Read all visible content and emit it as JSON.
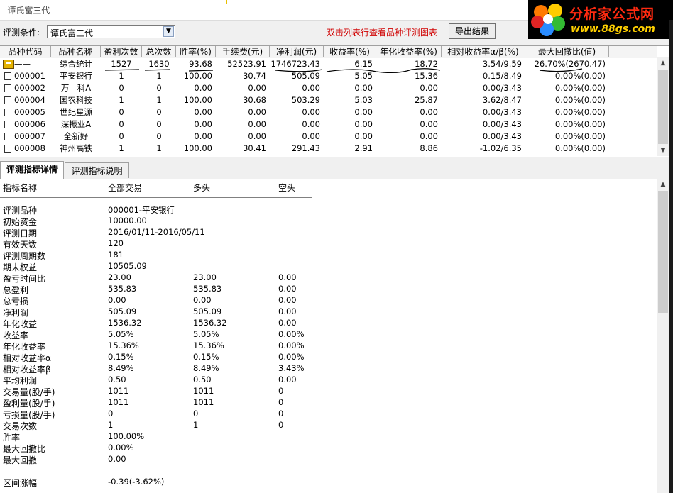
{
  "window": {
    "title": "-谭氏富三代"
  },
  "logo": {
    "name": "分析家公式网",
    "url": "www.88gs.com"
  },
  "toolbar": {
    "condition_label": "评测条件:",
    "condition_value": "谭氏富三代",
    "hint": "双击列表行查看品种评测图表",
    "export_label": "导出结果"
  },
  "table": {
    "headers": [
      "品种代码",
      "品种名称",
      "盈利次数",
      "总次数",
      "胜率(%)",
      "手续费(元)",
      "净利润(元)",
      "收益率(%)",
      "年化收益率(%)",
      "相对收益率α/β(%)",
      "最大回撤比(值)"
    ],
    "summary": {
      "code": "——",
      "name": "综合统计",
      "win_count": "1527",
      "total_count": "1630",
      "win_rate": "93.68",
      "fee": "52523.91",
      "net_profit": "1746723.43",
      "return_rate": "6.15",
      "annual_return": "18.72",
      "alpha_beta": "3.54/9.59",
      "max_drawdown": "26.70%(2670.47)"
    },
    "rows": [
      {
        "code": "000001",
        "name": "平安银行",
        "win_count": "1",
        "total_count": "1",
        "win_rate": "100.00",
        "fee": "30.74",
        "net_profit": "505.09",
        "return_rate": "5.05",
        "annual_return": "15.36",
        "alpha_beta": "0.15/8.49",
        "max_drawdown": "0.00%(0.00)"
      },
      {
        "code": "000002",
        "name": "万　科A",
        "win_count": "0",
        "total_count": "0",
        "win_rate": "0.00",
        "fee": "0.00",
        "net_profit": "0.00",
        "return_rate": "0.00",
        "annual_return": "0.00",
        "alpha_beta": "0.00/3.43",
        "max_drawdown": "0.00%(0.00)"
      },
      {
        "code": "000004",
        "name": "国农科技",
        "win_count": "1",
        "total_count": "1",
        "win_rate": "100.00",
        "fee": "30.68",
        "net_profit": "503.29",
        "return_rate": "5.03",
        "annual_return": "25.87",
        "alpha_beta": "3.62/8.47",
        "max_drawdown": "0.00%(0.00)"
      },
      {
        "code": "000005",
        "name": "世纪星源",
        "win_count": "0",
        "total_count": "0",
        "win_rate": "0.00",
        "fee": "0.00",
        "net_profit": "0.00",
        "return_rate": "0.00",
        "annual_return": "0.00",
        "alpha_beta": "0.00/3.43",
        "max_drawdown": "0.00%(0.00)"
      },
      {
        "code": "000006",
        "name": "深振业A",
        "win_count": "0",
        "total_count": "0",
        "win_rate": "0.00",
        "fee": "0.00",
        "net_profit": "0.00",
        "return_rate": "0.00",
        "annual_return": "0.00",
        "alpha_beta": "0.00/3.43",
        "max_drawdown": "0.00%(0.00)"
      },
      {
        "code": "000007",
        "name": "全新好",
        "win_count": "0",
        "total_count": "0",
        "win_rate": "0.00",
        "fee": "0.00",
        "net_profit": "0.00",
        "return_rate": "0.00",
        "annual_return": "0.00",
        "alpha_beta": "0.00/3.43",
        "max_drawdown": "0.00%(0.00)"
      },
      {
        "code": "000008",
        "name": "神州高铁",
        "win_count": "1",
        "total_count": "1",
        "win_rate": "100.00",
        "fee": "30.41",
        "net_profit": "291.43",
        "return_rate": "2.91",
        "annual_return": "8.86",
        "alpha_beta": "-1.02/6.35",
        "max_drawdown": "0.00%(0.00)"
      }
    ]
  },
  "tabs": [
    {
      "label": "评测指标详情",
      "active": true
    },
    {
      "label": "评测指标说明",
      "active": false
    }
  ],
  "detail": {
    "header": {
      "name": "指标名称",
      "all": "全部交易",
      "long": "多头",
      "short": "空头"
    },
    "rows": [
      {
        "label": "评测品种",
        "all": "000001-平安银行",
        "long": "",
        "short": ""
      },
      {
        "label": "初始资金",
        "all": "10000.00",
        "long": "",
        "short": ""
      },
      {
        "label": "评测日期",
        "all": "2016/01/11-2016/05/11",
        "long": "",
        "short": ""
      },
      {
        "label": "有效天数",
        "all": "120",
        "long": "",
        "short": ""
      },
      {
        "label": "评测周期数",
        "all": "181",
        "long": "",
        "short": ""
      },
      {
        "label": "期末权益",
        "all": "10505.09",
        "long": "",
        "short": ""
      },
      {
        "label": "盈亏时间比",
        "all": "23.00",
        "long": "23.00",
        "short": "0.00"
      },
      {
        "label": "总盈利",
        "all": "535.83",
        "long": "535.83",
        "short": "0.00"
      },
      {
        "label": "总亏损",
        "all": "0.00",
        "long": "0.00",
        "short": "0.00"
      },
      {
        "label": "净利润",
        "all": "505.09",
        "long": "505.09",
        "short": "0.00"
      },
      {
        "label": "年化收益",
        "all": "1536.32",
        "long": "1536.32",
        "short": "0.00"
      },
      {
        "label": "收益率",
        "all": "5.05%",
        "long": "5.05%",
        "short": "0.00%"
      },
      {
        "label": "年化收益率",
        "all": "15.36%",
        "long": "15.36%",
        "short": "0.00%"
      },
      {
        "label": "相对收益率α",
        "all": "0.15%",
        "long": "0.15%",
        "short": "0.00%"
      },
      {
        "label": "相对收益率β",
        "all": "8.49%",
        "long": "8.49%",
        "short": "3.43%"
      },
      {
        "label": "平均利润",
        "all": "0.50",
        "long": "0.50",
        "short": "0.00"
      },
      {
        "label": "交易量(股/手)",
        "all": "1011",
        "long": "1011",
        "short": "0"
      },
      {
        "label": "盈利量(股/手)",
        "all": "1011",
        "long": "1011",
        "short": "0"
      },
      {
        "label": "亏损量(股/手)",
        "all": "0",
        "long": "0",
        "short": "0"
      },
      {
        "label": "交易次数",
        "all": "1",
        "long": "1",
        "short": "0"
      },
      {
        "label": "胜率",
        "all": "100.00%",
        "long": "",
        "short": ""
      },
      {
        "label": "最大回撤比",
        "all": "0.00%",
        "long": "",
        "short": ""
      },
      {
        "label": "最大回撤",
        "all": "0.00",
        "long": "",
        "short": ""
      },
      {
        "label": "",
        "all": "",
        "long": "",
        "short": ""
      },
      {
        "label": "区间涨幅",
        "all": "-0.39(-3.62%)",
        "long": "",
        "short": ""
      }
    ]
  },
  "colors": {
    "hint": "#d00000",
    "logo_name": "#ff2a10",
    "logo_url": "#ffd000",
    "summary_icon": "#e4b200"
  }
}
